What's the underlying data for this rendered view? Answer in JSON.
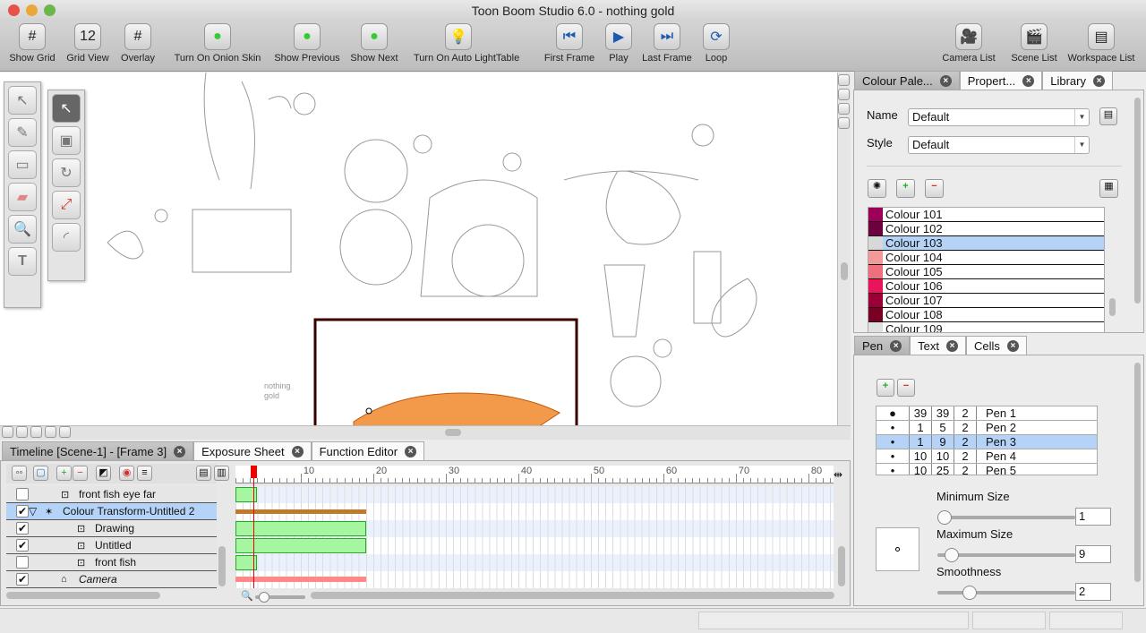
{
  "window": {
    "title": "Toon Boom Studio 6.0 - nothing gold"
  },
  "toolbar": [
    {
      "label": "Show Grid",
      "icon": "grid-icon",
      "glyph": "#"
    },
    {
      "label": "Grid View",
      "icon": "grid-view-icon",
      "glyph": "12"
    },
    {
      "label": "Overlay",
      "icon": "overlay-icon",
      "glyph": "#"
    },
    {
      "label": "Turn On Onion Skin",
      "icon": "onion-skin-icon",
      "glyph": "●"
    },
    {
      "label": "Show Previous",
      "icon": "show-previous-icon",
      "glyph": "●"
    },
    {
      "label": "Show Next",
      "icon": "show-next-icon",
      "glyph": "●"
    },
    {
      "label": "Turn On Auto LightTable",
      "icon": "lightbulb-icon",
      "glyph": "💡"
    },
    {
      "label": "First Frame",
      "icon": "first-frame-icon",
      "glyph": "⏮"
    },
    {
      "label": "Play",
      "icon": "play-icon",
      "glyph": "▶"
    },
    {
      "label": "Last Frame",
      "icon": "last-frame-icon",
      "glyph": "⏭"
    },
    {
      "label": "Loop",
      "icon": "loop-icon",
      "glyph": "⟳"
    },
    {
      "label": "Camera List",
      "icon": "camera-icon",
      "glyph": "🎥"
    },
    {
      "label": "Scene List",
      "icon": "clapper-icon",
      "glyph": "🎬"
    },
    {
      "label": "Workspace List",
      "icon": "workspace-icon",
      "glyph": "▤"
    }
  ],
  "canvas": {
    "sketch_text": "nothing gold"
  },
  "timeline": {
    "tabs": [
      {
        "label": "Timeline [Scene-1] - [Frame 3]",
        "active": true
      },
      {
        "label": "Exposure Sheet"
      },
      {
        "label": "Function Editor"
      }
    ],
    "ruler": [
      "10",
      "20",
      "30",
      "40",
      "50",
      "60",
      "70",
      "80"
    ],
    "current_frame": 3,
    "layers": [
      {
        "name": "front fish eye far",
        "checked": false,
        "indent": 2,
        "end": 3
      },
      {
        "name": "Colour Transform-Untitled 2",
        "checked": true,
        "indent": 1,
        "selected": true,
        "expanded": true,
        "end": 18
      },
      {
        "name": "Drawing",
        "checked": true,
        "indent": 3,
        "end": 18
      },
      {
        "name": "Untitled",
        "checked": true,
        "indent": 3,
        "end": 18
      },
      {
        "name": "front fish",
        "checked": false,
        "indent": 3,
        "end": 3
      },
      {
        "name": "Camera",
        "checked": true,
        "indent": 2,
        "italic": true,
        "end": 18
      }
    ]
  },
  "colour_palette": {
    "tabs": [
      {
        "label": "Colour Pale...",
        "active": true
      },
      {
        "label": "Propert..."
      },
      {
        "label": "Library"
      }
    ],
    "name_label": "Name",
    "name_value": "Default",
    "style_label": "Style",
    "style_value": "Default",
    "colours": [
      {
        "name": "Colour 101",
        "color": "#9c0058"
      },
      {
        "name": "Colour 102",
        "color": "#6e0040"
      },
      {
        "name": "Colour 103",
        "color": "#d8d8d8",
        "selected": true
      },
      {
        "name": "Colour 104",
        "color": "#f29a9a"
      },
      {
        "name": "Colour 105",
        "color": "#ee6f7d"
      },
      {
        "name": "Colour 106",
        "color": "#e8155a"
      },
      {
        "name": "Colour 107",
        "color": "#9a0035"
      },
      {
        "name": "Colour 108",
        "color": "#780023"
      },
      {
        "name": "Colour 109",
        "color": "#e0e0e0"
      }
    ]
  },
  "pen": {
    "tabs": [
      {
        "label": "Pen",
        "active": true
      },
      {
        "label": "Text"
      },
      {
        "label": "Cells"
      }
    ],
    "pens": [
      {
        "min": "39",
        "max": "39",
        "smooth": "2",
        "name": "Pen 1"
      },
      {
        "min": "1",
        "max": "5",
        "smooth": "2",
        "name": "Pen 2"
      },
      {
        "min": "1",
        "max": "9",
        "smooth": "2",
        "name": "Pen 3",
        "selected": true
      },
      {
        "min": "10",
        "max": "10",
        "smooth": "2",
        "name": "Pen 4"
      },
      {
        "min": "10",
        "max": "25",
        "smooth": "2",
        "name": "Pen 5"
      }
    ],
    "min_label": "Minimum Size",
    "min_value": "1",
    "max_label": "Maximum Size",
    "max_value": "9",
    "smooth_label": "Smoothness",
    "smooth_value": "2",
    "min_level": 0.0,
    "max_level": 0.06,
    "smooth_level": 0.2
  }
}
